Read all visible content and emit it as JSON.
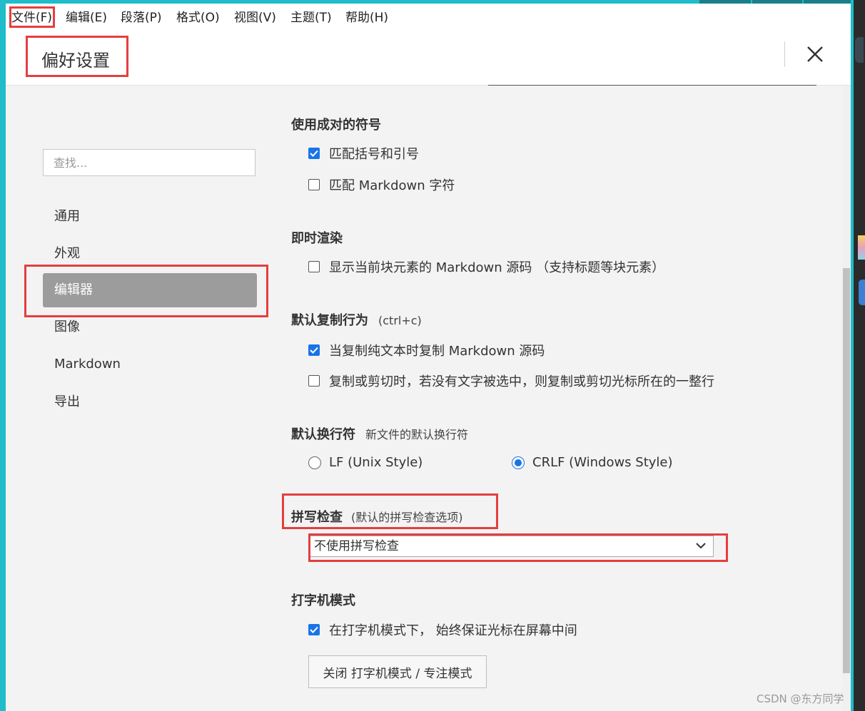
{
  "menu": {
    "items": [
      "文件(F)",
      "编辑(E)",
      "段落(P)",
      "格式(O)",
      "视图(V)",
      "主题(T)",
      "帮助(H)"
    ]
  },
  "header": {
    "title": "偏好设置"
  },
  "sidebar": {
    "search_placeholder": "查找...",
    "items": [
      {
        "label": "通用"
      },
      {
        "label": "外观"
      },
      {
        "label": "编辑器"
      },
      {
        "label": "图像"
      },
      {
        "label": "Markdown"
      },
      {
        "label": "导出"
      }
    ],
    "active": "编辑器"
  },
  "sections": {
    "pairs": {
      "title": "使用成对的符号",
      "options": [
        {
          "label": "匹配括号和引号",
          "checked": true
        },
        {
          "label": "匹配 Markdown 字符",
          "checked": false
        }
      ]
    },
    "live": {
      "title": "即时渲染",
      "options": [
        {
          "label": "显示当前块元素的 Markdown 源码 （支持标题等块元素）",
          "checked": false
        }
      ]
    },
    "copy": {
      "title": "默认复制行为",
      "note": "(ctrl+c)",
      "options": [
        {
          "label": "当复制纯文本时复制 Markdown 源码",
          "checked": true
        },
        {
          "label": "复制或剪切时，若没有文字被选中，则复制或剪切光标所在的一整行",
          "checked": false
        }
      ]
    },
    "linebreak": {
      "title": "默认换行符",
      "note": "新文件的默认换行符",
      "options": [
        {
          "label": "LF (Unix Style)",
          "selected": false
        },
        {
          "label": "CRLF (Windows Style)",
          "selected": true
        }
      ]
    },
    "spell": {
      "title": "拼写检查",
      "note": "(默认的拼写检查选项)",
      "select_value": "不使用拼写检查"
    },
    "typewriter": {
      "title": "打字机模式",
      "options": [
        {
          "label": "在打字机模式下， 始终保证光标在屏幕中间",
          "checked": true
        }
      ],
      "button_label": "关闭 打字机模式 / 专注模式"
    }
  },
  "watermark": "CSDN @东方同学",
  "colors": {
    "accent": "#1a73e8",
    "highlight": "#e53e3e",
    "sidebar_active": "#9c9c9c",
    "frame": "#1fbcc9"
  }
}
